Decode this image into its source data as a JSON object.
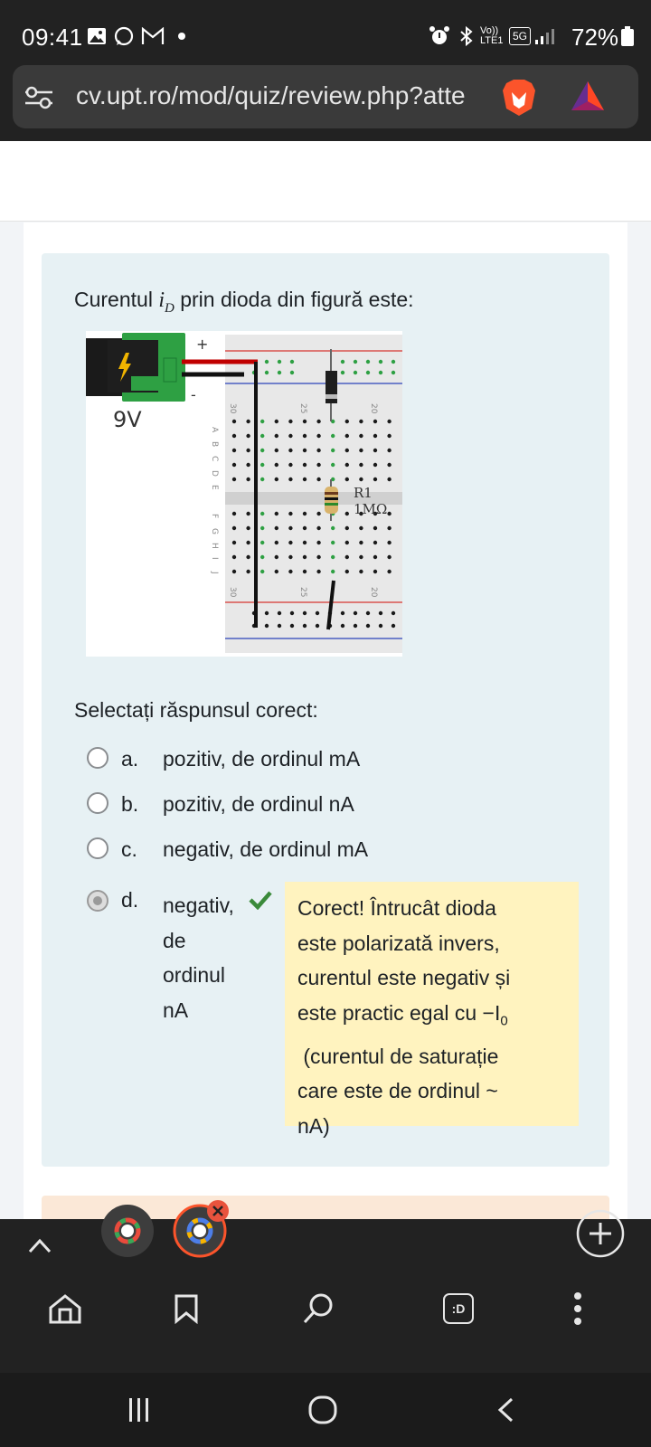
{
  "status_bar": {
    "time": "09:41",
    "battery": "72%",
    "network_label": "5G",
    "volte_label": "Vo)) LTE1"
  },
  "browser": {
    "url": "cv.upt.ro/mod/quiz/review.php?atte",
    "brave_icon": "brave-lion-icon",
    "rewards_icon": "bat-triangle-icon"
  },
  "question": {
    "prefix": "Curentul ",
    "var_main": "i",
    "var_sub": "D",
    "suffix": " prin dioda din figură este:",
    "figure": {
      "battery_label": "9V",
      "plus": "+",
      "minus": "-",
      "resistor_name": "R1",
      "resistor_value": "1MΩ",
      "col_labels_top": [
        "30",
        "25",
        "20"
      ],
      "col_labels_bottom": [
        "30",
        "25",
        "20"
      ],
      "row_labels_top": [
        "A",
        "B",
        "C",
        "D",
        "E"
      ],
      "row_labels_bottom": [
        "F",
        "G",
        "H",
        "I",
        "J"
      ]
    },
    "select_label": "Selectați răspunsul corect:",
    "options": [
      {
        "letter": "a.",
        "text": "pozitiv, de ordinul mA",
        "checked": false
      },
      {
        "letter": "b.",
        "text": "pozitiv, de ordinul nA",
        "checked": false
      },
      {
        "letter": "c.",
        "text": "negativ, de ordinul mA",
        "checked": false
      },
      {
        "letter": "d.",
        "text": "negativ, de ordinul nA",
        "checked": true
      }
    ],
    "option_d_lines": [
      "negativ,",
      "de",
      "ordinul",
      "nA"
    ],
    "feedback_lines": [
      "Corect! Întrucât dioda",
      "este polarizată invers,",
      "curentul este negativ și",
      "este practic egal cu −I",
      " (curentul de saturație",
      "care este de ordinul ~",
      "nA)"
    ],
    "feedback_sub": "0"
  },
  "bottom_bar": {
    "tab_switcher_label": ":D"
  },
  "colors": {
    "card_bg": "#e7f1f4",
    "feedback_bg": "#fff3bf",
    "check": "#3a8a3a",
    "chrome_bg": "#222222"
  }
}
